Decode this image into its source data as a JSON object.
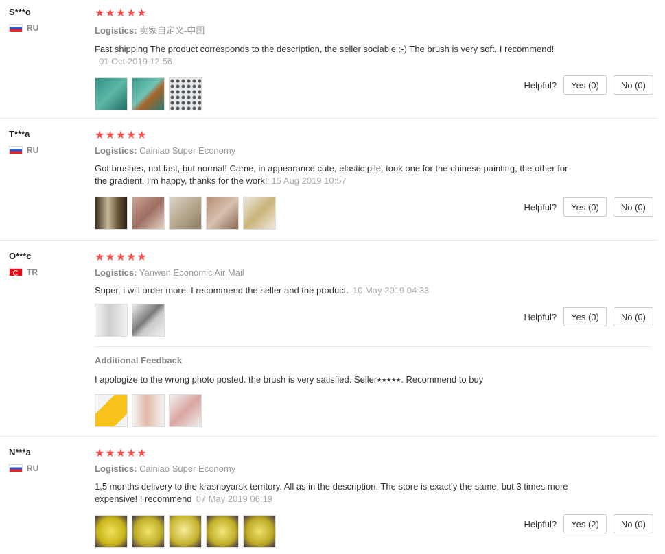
{
  "helpful_label": "Helpful?",
  "reviews": [
    {
      "user": "S***o",
      "country": "RU",
      "stars": "★★★★★",
      "logistics_label": "Logistics:",
      "logistics": "卖家自定义-中国",
      "text": "Fast shipping The product corresponds to the description, the seller sociable :-) The brush is very soft. I recommend!",
      "date": "01 Oct 2019 12:56",
      "yes": "Yes (0)",
      "no": "No (0)"
    },
    {
      "user": "T***a",
      "country": "RU",
      "stars": "★★★★★",
      "logistics_label": "Logistics:",
      "logistics": "Cainiao Super Economy",
      "text": "Got brushes, not fast, but normal! Came, in appearance cute, elastic pile, took one for the chinese painting, the other for the gradient. I'm happy, thanks for the work!",
      "date": "15 Aug 2019 10:57",
      "yes": "Yes (0)",
      "no": "No (0)"
    },
    {
      "user": "O***c",
      "country": "TR",
      "stars": "★★★★★",
      "logistics_label": "Logistics:",
      "logistics": "Yanwen Economic Air Mail",
      "text": "Super, i will order more. I recommend the seller and the product.",
      "date": "10 May 2019 04:33",
      "yes": "Yes (0)",
      "no": "No (0)",
      "additional_title": "Additional Feedback",
      "additional_text": "I apologize to the wrong photo posted. the brush is very satisfied. Seller⭑⭑⭑⭑⭑. Recommend to buy"
    },
    {
      "user": "N***a",
      "country": "RU",
      "stars": "★★★★★",
      "logistics_label": "Logistics:",
      "logistics": "Cainiao Super Economy",
      "text": "1,5 months delivery to the krasnoyarsk territory. All as in the description. The store is exactly the same, but 3 times more expensive! I recommend",
      "date": "07 May 2019 06:19",
      "yes": "Yes (2)",
      "no": "No (0)"
    }
  ],
  "colors": {
    "star": "#f44a4a",
    "muted": "#999999"
  }
}
